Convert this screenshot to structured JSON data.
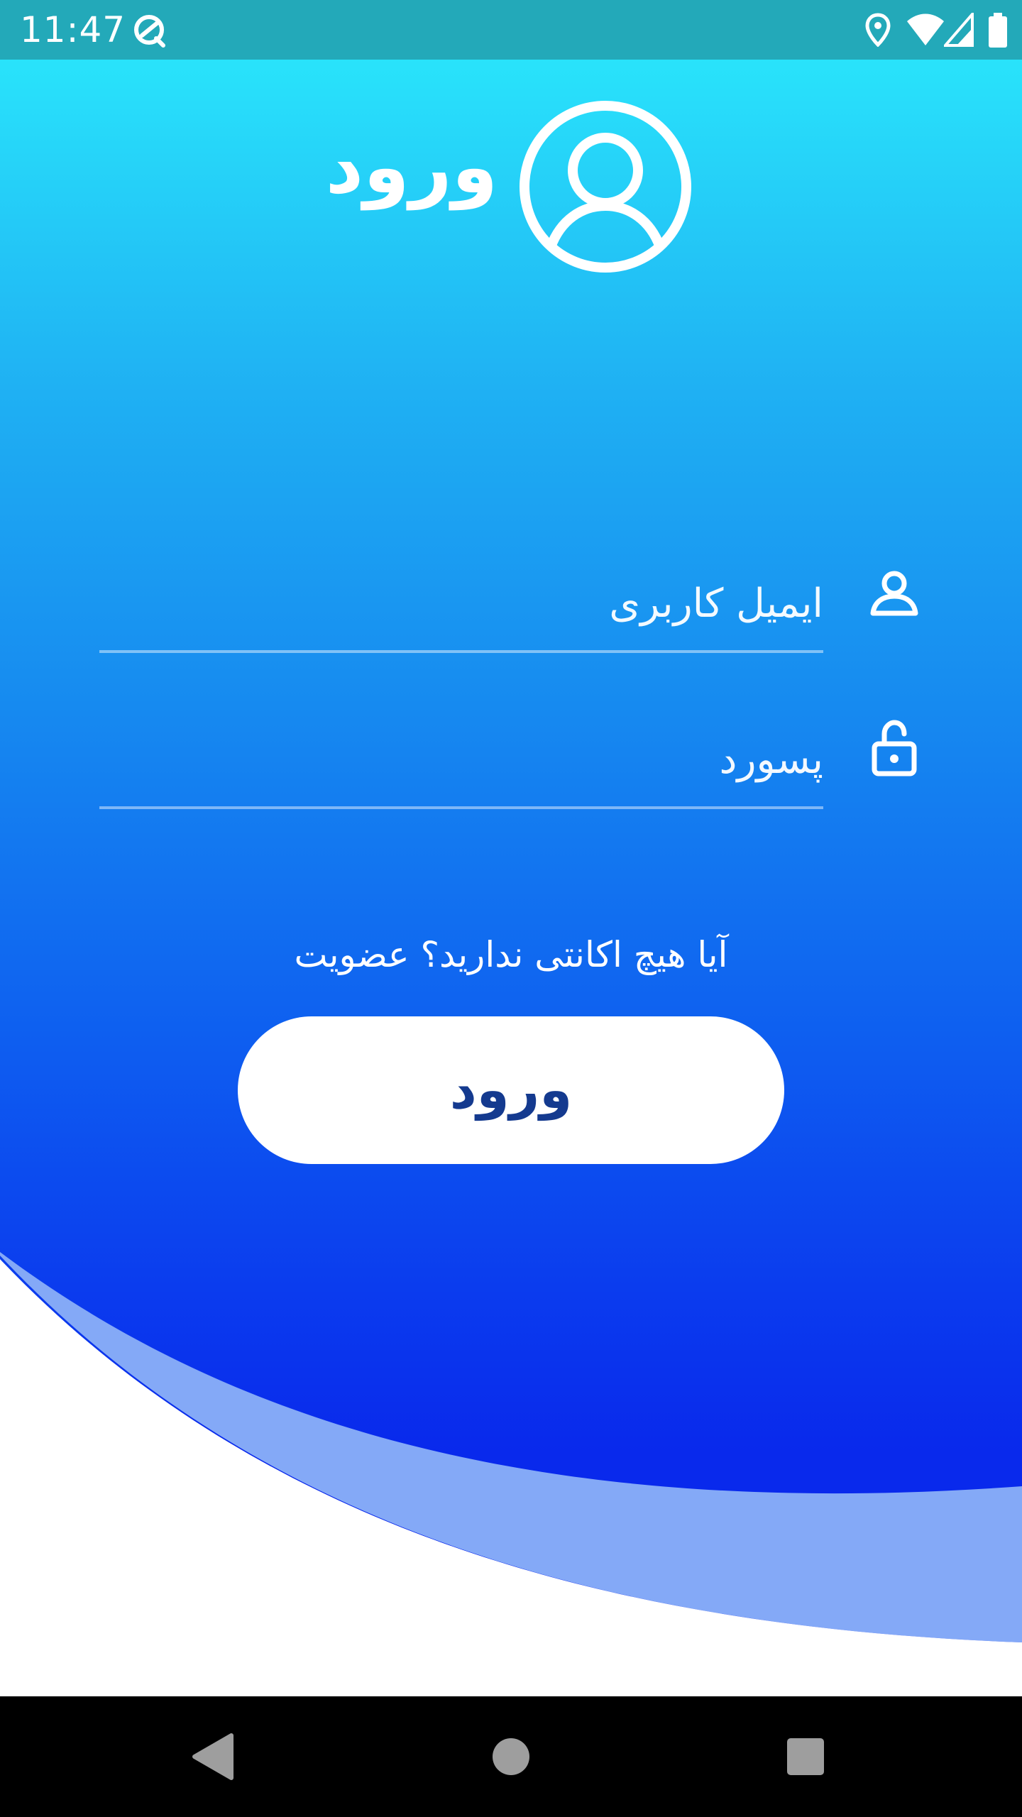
{
  "status_bar": {
    "time": "11:47"
  },
  "header": {
    "title": "ورود",
    "icon": "user-circle-icon"
  },
  "form": {
    "email_placeholder": "ایمیل کاربری",
    "email_icon": "user-icon",
    "password_placeholder": "پسورد",
    "password_icon": "lock-icon"
  },
  "signup_text": "آیا هیچ اکانتی ندارید؟ عضویت",
  "login_button_label": "ورود",
  "colors": {
    "status_bar": "#23a9b9",
    "gradient_top": "#29e3fb",
    "gradient_bottom": "#0929ec",
    "wave_light": "#84a9f7",
    "button_text": "#143a8f"
  },
  "nav": {
    "back_icon": "back-triangle-icon",
    "home_icon": "home-circle-icon",
    "recents_icon": "recents-square-icon"
  }
}
